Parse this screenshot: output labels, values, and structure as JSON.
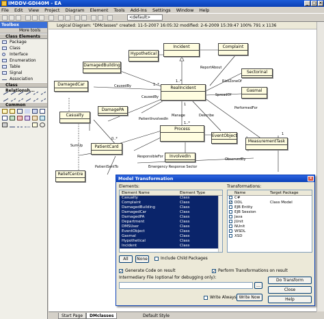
{
  "window": {
    "title": "IMDDV-GDI40M - EA"
  },
  "menu": [
    "File",
    "Edit",
    "View",
    "Project",
    "Diagram",
    "Element",
    "Tools",
    "Add-Ins",
    "Settings",
    "Window",
    "Help"
  ],
  "toolbar": {
    "combo_value": "<default>"
  },
  "toolbox": {
    "title": "Toolbox",
    "more_tools": "More tools",
    "sections": [
      {
        "name": "Class Elements",
        "items": [
          "Package",
          "Class",
          "Interface",
          "Enumeration",
          "Table",
          "Signal",
          "Association"
        ]
      },
      {
        "name": "Class Relationsh..."
      },
      {
        "name": "Common"
      }
    ]
  },
  "diagram": {
    "header": "Logical Diagram: \"DMclasses\"  created: 11-5-2007 16:05:32  modified: 2-6-2009 15:39:47  100%  791 x 1136",
    "classes": [
      "Incident",
      "Complaint",
      "Hypothetical",
      "DamagedBuilding",
      "DamagedCar",
      "RealIncident",
      "Sectorinal",
      "Gasmal",
      "DamagePA",
      "Casualty",
      "Process",
      "EventObject",
      "MeasurementTask",
      "PatientCard",
      "ReliefCentre",
      "InvolvedIn"
    ],
    "labels": [
      "ReportAbout",
      "RiskZoneOf",
      "CausedBy",
      "CausedBy",
      "Manage",
      "Describe",
      "PerformedFor",
      "SpreadOf",
      "PatientInvolvedIn",
      "SumUp",
      "PatientSentTo",
      "ResponsibleFor",
      "Emergency Response Sector",
      "ObservedBy",
      "1..*",
      "1..*",
      "1",
      "1..*",
      "0..*",
      "1"
    ]
  },
  "tabs": [
    "Start Page",
    "DMclasses"
  ],
  "status": "Default Style",
  "dialog": {
    "title": "Model Transformation",
    "elements_label": "Elements:",
    "elements_columns": [
      "Element Name",
      "Element Type"
    ],
    "elements": [
      [
        "Casualty",
        "Class"
      ],
      [
        "Complaint",
        "Class"
      ],
      [
        "DamagedBuilding",
        "Class"
      ],
      [
        "DamagedCar",
        "Class"
      ],
      [
        "DamagedPA",
        "Class"
      ],
      [
        "Department",
        "Class"
      ],
      [
        "DMSUser",
        "Class"
      ],
      [
        "EventObject",
        "Class"
      ],
      [
        "Gasmal",
        "Class"
      ],
      [
        "Hypothetical",
        "Class"
      ],
      [
        "Incident",
        "Class"
      ]
    ],
    "all_button": "All",
    "none_button": "None",
    "include_child": "Include Child Packages",
    "transformations_label": "Transformations:",
    "transformations_columns": [
      "Name",
      "Target Package"
    ],
    "transformations": [
      {
        "name": "C#",
        "checked": false,
        "target": ""
      },
      {
        "name": "DDL",
        "checked": true,
        "target": "Class Model"
      },
      {
        "name": "EJB Entity",
        "checked": false,
        "target": ""
      },
      {
        "name": "EJB Session",
        "checked": false,
        "target": ""
      },
      {
        "name": "Java",
        "checked": false,
        "target": ""
      },
      {
        "name": "JUnit",
        "checked": false,
        "target": ""
      },
      {
        "name": "NUnit",
        "checked": false,
        "target": ""
      },
      {
        "name": "WSDL",
        "checked": false,
        "target": ""
      },
      {
        "name": "XSD",
        "checked": false,
        "target": ""
      }
    ],
    "generate_code": "Generate Code on result",
    "perform_transformations": "Perform Transformations on result",
    "intermediary_label": "Intermediary File (optional for debugging only):",
    "intermediary_value": "",
    "write_always": "Write Always",
    "write_now": "Write Now",
    "do_transform": "Do Transform",
    "close": "Close",
    "help": "Help"
  }
}
